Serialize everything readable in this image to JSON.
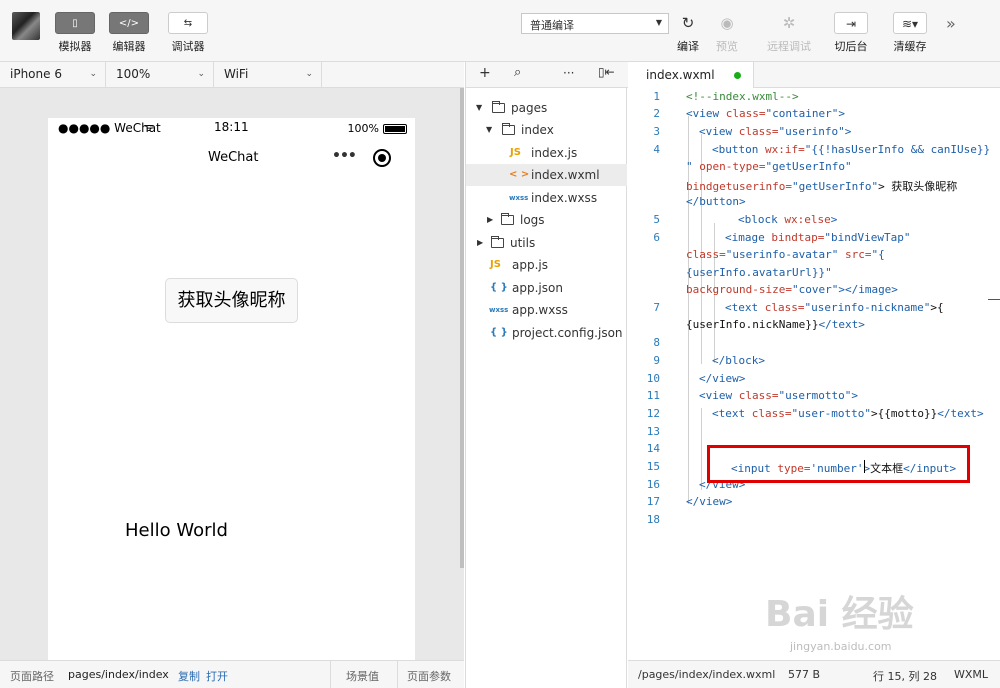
{
  "toolbar": {
    "simulator_label": "模拟器",
    "editor_label": "编辑器",
    "debugger_label": "调试器",
    "compile_mode": "普通编译",
    "compile_label": "编译",
    "preview_label": "预览",
    "remote_debug_label": "远程调试",
    "switch_bg_label": "切后台",
    "clear_cache_label": "清缓存"
  },
  "simulator": {
    "device": "iPhone 6",
    "zoom": "100%",
    "network": "WiFi",
    "status_carrier": "●●●●● WeChat",
    "status_time": "18:11",
    "status_battery": "100%",
    "nav_title": "WeChat",
    "get_avatar_button": "获取头像昵称",
    "hello_text": "Hello World"
  },
  "bottom_bar": {
    "path_label": "页面路径",
    "path_value": "pages/index/index",
    "copy": "复制",
    "open": "打开",
    "scene_label": "场景值",
    "page_params_label": "页面参数"
  },
  "file_tree": [
    {
      "name": "pages",
      "type": "folder",
      "expanded": true
    },
    {
      "name": "index",
      "type": "folder",
      "expanded": true
    },
    {
      "name": "index.js",
      "type": "js",
      "badge": "JS"
    },
    {
      "name": "index.wxml",
      "type": "wxml",
      "badge": "< >",
      "selected": true
    },
    {
      "name": "index.wxss",
      "type": "wxss",
      "badge": "wxss"
    },
    {
      "name": "logs",
      "type": "folder",
      "expanded": false
    },
    {
      "name": "utils",
      "type": "folder",
      "expanded": false
    },
    {
      "name": "app.js",
      "type": "js",
      "badge": "JS"
    },
    {
      "name": "app.json",
      "type": "json",
      "badge": "{ }"
    },
    {
      "name": "app.wxss",
      "type": "wxss",
      "badge": "wxss"
    },
    {
      "name": "project.config.json",
      "type": "json",
      "badge": "{ }"
    }
  ],
  "editor": {
    "tab_name": "index.wxml",
    "line_numbers": [
      "1",
      "2",
      "3",
      "4",
      "5",
      "6",
      "7",
      "8",
      "9",
      "10",
      "11",
      "12",
      "13",
      "14",
      "15",
      "16",
      "17",
      "18"
    ],
    "code": {
      "l1": "<!--index.wxml-->",
      "l2a": "<view ",
      "l2b": "class=",
      "l2c": "\"container\"",
      "l2d": ">",
      "l3a": "<view ",
      "l3b": "class=",
      "l3c": "\"userinfo\"",
      "l3d": ">",
      "l4a": "<button ",
      "l4b": "wx:if=",
      "l4c": "\"{{!hasUserInfo && canIUse}}",
      "l4d": "\" ",
      "l4e": "open-type=",
      "l4f": "\"getUserInfo\"",
      "l4g": "bindgetuserinfo=",
      "l4h": "\"getUserInfo\"",
      "l4i": "> 获取头像昵称",
      "l4j": "</button>",
      "l5a": "<block ",
      "l5b": "wx:else",
      "l5c": ">",
      "l6a": "<image ",
      "l6b": "bindtap=",
      "l6c": "\"bindViewTap\"",
      "l6d": "class=",
      "l6e": "\"userinfo-avatar\" ",
      "l6f": "src=",
      "l6g": "\"{",
      "l6h": "{userInfo.avatarUrl}}\"",
      "l6i": "background-size=",
      "l6j": "\"cover\"",
      "l6k": "></image>",
      "l7a": "<text ",
      "l7b": "class=",
      "l7c": "\"userinfo-nickname\"",
      "l7d": ">{",
      "l7e": "{userInfo.nickName}}",
      "l7f": "</text>",
      "l9": "</block>",
      "l10": "</view>",
      "l11a": "<view ",
      "l11b": "class=",
      "l11c": "\"usermotto\"",
      "l11d": ">",
      "l12a": "<text ",
      "l12b": "class=",
      "l12c": "\"user-motto\"",
      "l12d": ">{{motto}}",
      "l12e": "</text>",
      "l15a": "<input ",
      "l15b": "type=",
      "l15c": "'number'",
      "l15d": ">",
      "l15e": "文本框",
      "l15f": "</input>",
      "l16": "</view>",
      "l17": "</view>"
    }
  },
  "status_bar": {
    "path": "/pages/index/index.wxml",
    "size": "577 B",
    "position": "行 15, 列 28",
    "lang": "WXML"
  },
  "watermark": {
    "logo": "Bai 经验",
    "url": "jingyan.baidu.com"
  },
  "colors": {
    "highlight_box": "#e00000",
    "modified_dot": "#1aad19",
    "line_number": "#2b7bba"
  }
}
